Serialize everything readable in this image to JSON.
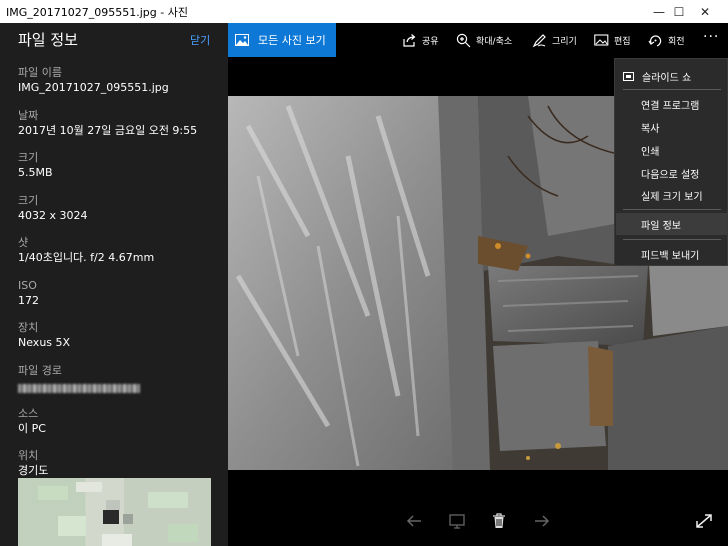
{
  "window": {
    "title": "IMG_20171027_095551.jpg - 사진",
    "minimize": "—",
    "maximize": "☐",
    "close": "✕"
  },
  "info": {
    "header": "파일 정보",
    "close_label": "닫기",
    "fields": [
      {
        "label": "파일 이름",
        "value": "IMG_20171027_095551.jpg"
      },
      {
        "label": "날짜",
        "value": "2017년 10월 27일 금요일 오전 9:55"
      },
      {
        "label": "크기",
        "value": "5.5MB"
      },
      {
        "label": "크기",
        "value": "4032 x 3024"
      },
      {
        "label": "샷",
        "value": "1/40초입니다. f/2 4.67mm"
      },
      {
        "label": "ISO",
        "value": "172"
      },
      {
        "label": "장치",
        "value": "Nexus 5X"
      },
      {
        "label": "파일 경로",
        "value": ""
      },
      {
        "label": "소스",
        "value": "이 PC"
      },
      {
        "label": "위치",
        "value": "경기도"
      }
    ]
  },
  "toolbar": {
    "all_photos": "모든 사진 보기",
    "share": "공유",
    "zoom": "확대/축소",
    "draw": "그리기",
    "edit": "편집",
    "rotate": "회전",
    "more": "···"
  },
  "menu": {
    "slideshow": "슬라이드 쇼",
    "items": [
      "연결 프로그램",
      "복사",
      "인쇄",
      "다음으로 설정",
      "실제 크기 보기",
      "파일 정보",
      "피드백 보내기"
    ]
  },
  "colors": {
    "accent": "#0e78d7",
    "link": "#4aa0ff",
    "pane": "#1e1e1e",
    "menu": "#2b2b2b"
  }
}
